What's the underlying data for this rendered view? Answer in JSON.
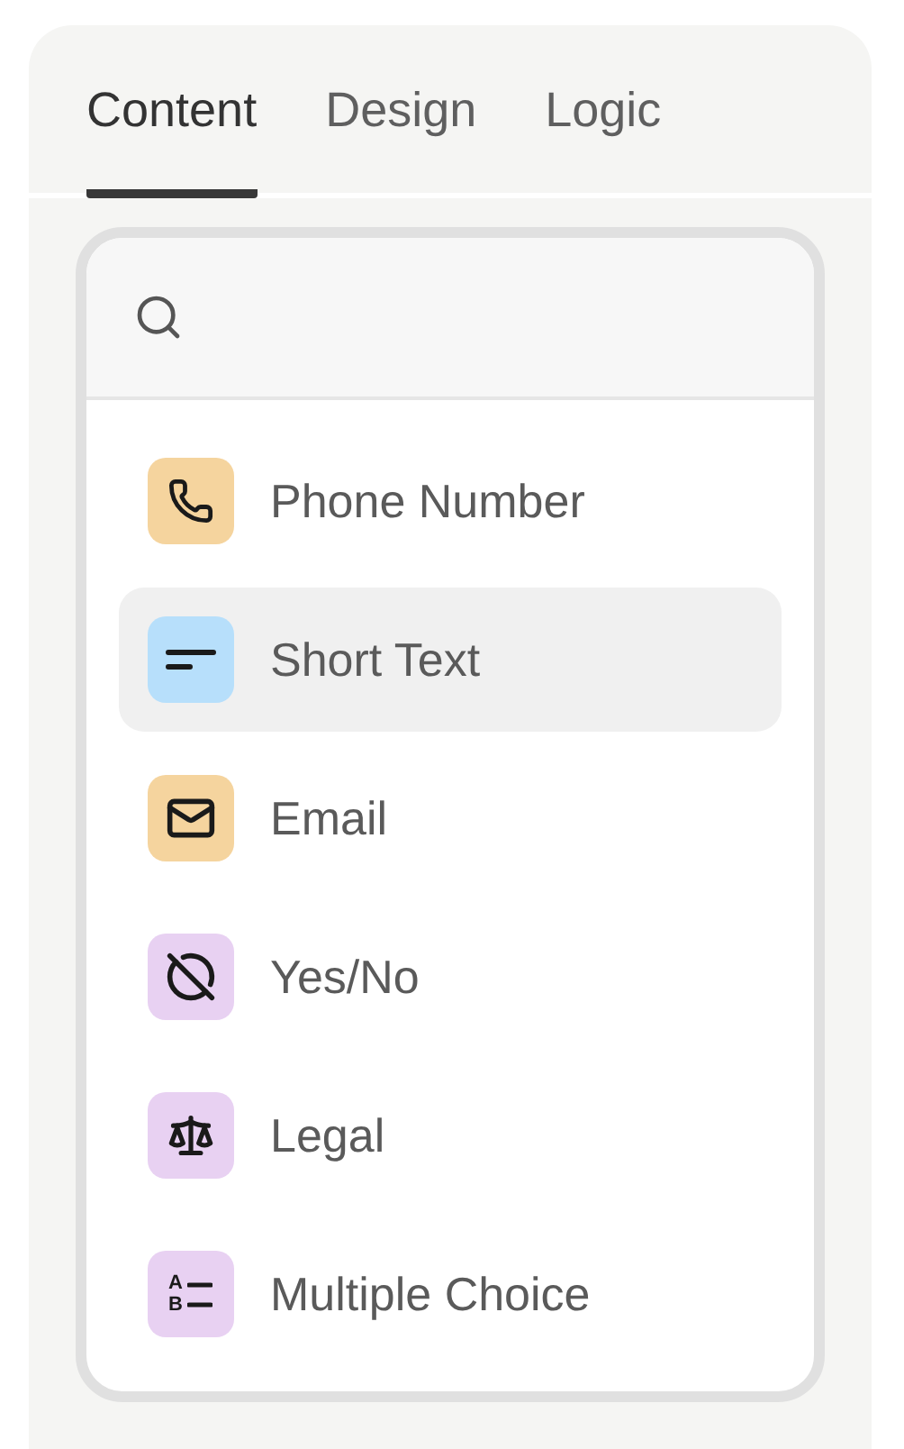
{
  "tabs": [
    {
      "label": "Content",
      "selected": true
    },
    {
      "label": "Design",
      "selected": false
    },
    {
      "label": "Logic",
      "selected": false
    }
  ],
  "fields": [
    {
      "label": "Phone Number",
      "kind": "phone",
      "color": "#f5d49e",
      "selected": false
    },
    {
      "label": "Short Text",
      "kind": "short_text",
      "color": "#b7dffb",
      "selected": true
    },
    {
      "label": "Email",
      "kind": "email",
      "color": "#f5d49e",
      "selected": false
    },
    {
      "label": "Yes/No",
      "kind": "yes_no",
      "color": "#e8d1f2",
      "selected": false
    },
    {
      "label": "Legal",
      "kind": "legal",
      "color": "#e8d1f2",
      "selected": false
    },
    {
      "label": "Multiple Choice",
      "kind": "choice",
      "color": "#e8d1f2",
      "selected": false,
      "letters": [
        "A",
        "B"
      ]
    }
  ]
}
